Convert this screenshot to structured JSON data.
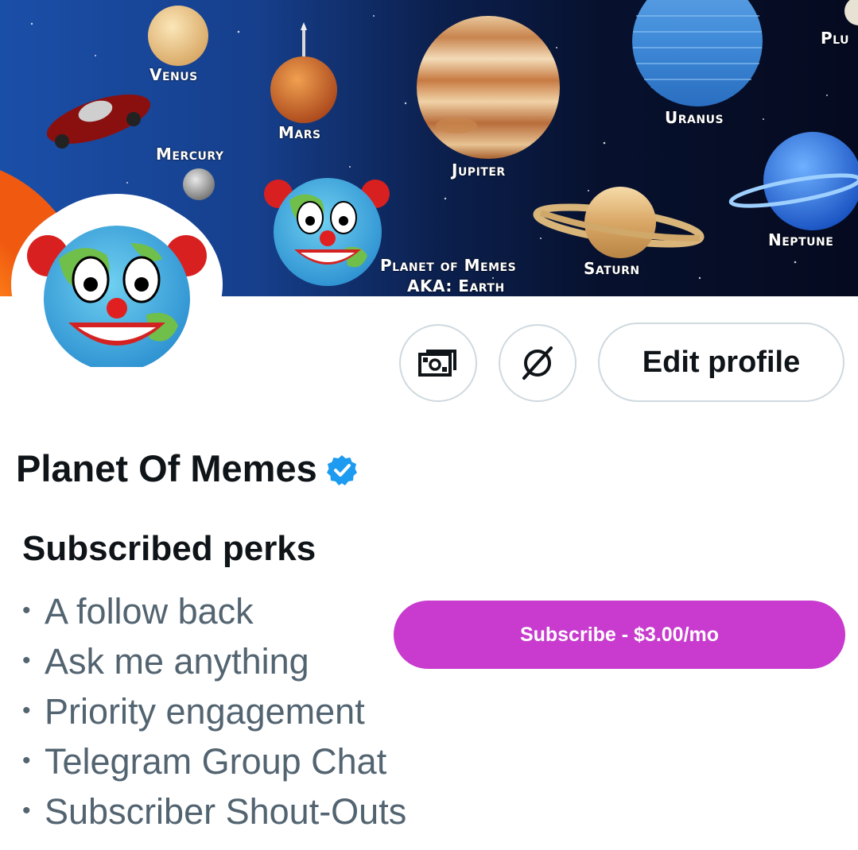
{
  "banner": {
    "planets": [
      "Venus",
      "Mars",
      "Mercury",
      "Jupiter",
      "Uranus",
      "Plu",
      "Neptune",
      "Saturn"
    ],
    "earth_label_line1": "Planet of Memes",
    "earth_label_line2": "AKA: Earth"
  },
  "profile": {
    "display_name": "Planet Of Memes",
    "verified": true,
    "avatar_icon": "clown-earth-icon"
  },
  "actions": {
    "tips_icon": "money-icon",
    "block_icon": "no-sign-icon",
    "edit_profile_label": "Edit profile"
  },
  "perks": {
    "title": "Subscribed perks",
    "items": [
      "A follow back",
      "Ask me anything",
      "Priority engagement",
      "Telegram Group Chat",
      "Subscriber Shout-Outs"
    ]
  },
  "subscribe": {
    "label": "Subscribe - $3.00/mo",
    "color": "#c83bce"
  },
  "colors": {
    "text_primary": "#0f1419",
    "text_secondary": "#536471",
    "verified_blue": "#1d9bf0",
    "button_border": "#cfd9de"
  }
}
